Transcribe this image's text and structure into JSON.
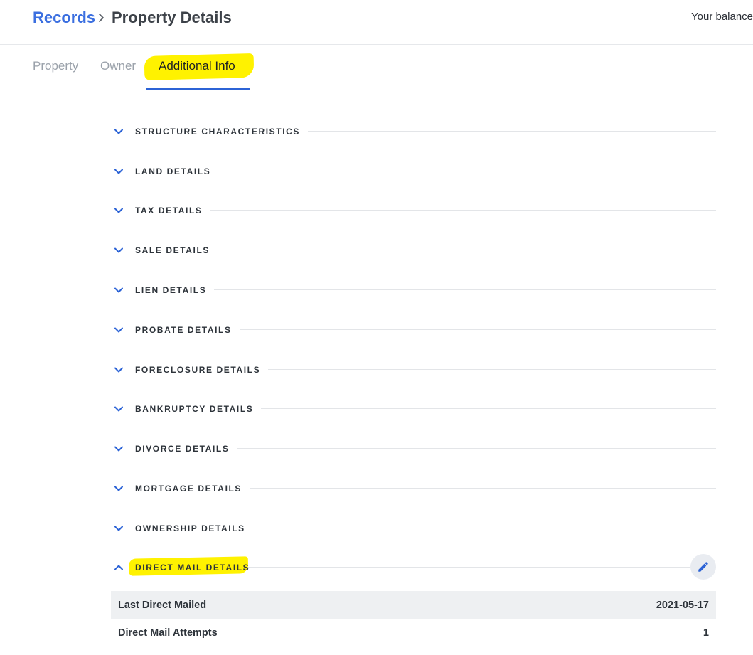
{
  "header": {
    "breadcrumb_root": "Records",
    "breadcrumb_current": "Property Details",
    "balance_label": "Your balance"
  },
  "tabs": [
    {
      "label": "Property"
    },
    {
      "label": "Owner"
    },
    {
      "label": "Additional Info",
      "active": true
    }
  ],
  "sections": [
    {
      "label": "STRUCTURE CHARACTERISTICS",
      "expanded": false
    },
    {
      "label": "LAND DETAILS",
      "expanded": false
    },
    {
      "label": "TAX DETAILS",
      "expanded": false
    },
    {
      "label": "SALE DETAILS",
      "expanded": false
    },
    {
      "label": "LIEN DETAILS",
      "expanded": false
    },
    {
      "label": "PROBATE DETAILS",
      "expanded": false
    },
    {
      "label": "FORECLOSURE DETAILS",
      "expanded": false
    },
    {
      "label": "BANKRUPTCY DETAILS",
      "expanded": false
    },
    {
      "label": "DIVORCE DETAILS",
      "expanded": false
    },
    {
      "label": "MORTGAGE DETAILS",
      "expanded": false
    },
    {
      "label": "OWNERSHIP DETAILS",
      "expanded": false
    },
    {
      "label": "DIRECT MAIL DETAILS",
      "expanded": true
    }
  ],
  "direct_mail": {
    "rows": [
      {
        "label": "Last Direct Mailed",
        "value": "2021-05-17"
      },
      {
        "label": "Direct Mail Attempts",
        "value": "1"
      }
    ]
  },
  "colors": {
    "accent": "#2c63d6",
    "link": "#3b6fe0",
    "highlight": "#fff200"
  },
  "icons": {
    "section_collapsed": "chevron-down-icon",
    "section_expanded": "chevron-up-icon",
    "edit": "pencil-icon",
    "breadcrumb_separator": "chevron-right-icon"
  }
}
